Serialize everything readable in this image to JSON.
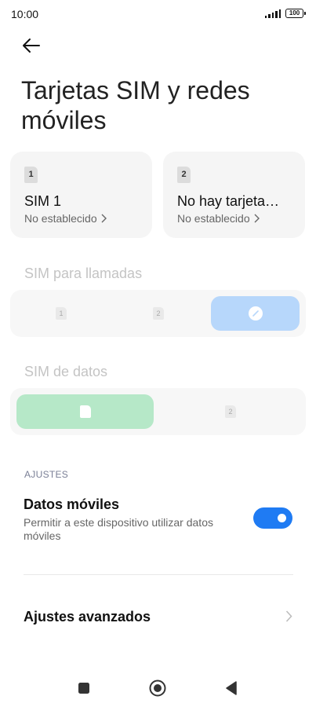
{
  "status_bar": {
    "time": "10:00",
    "battery": "100"
  },
  "header": {
    "back_icon": "arrow-left-icon",
    "title": "Tarjetas SIM y redes móviles"
  },
  "sim_cards": [
    {
      "chip": "1",
      "name": "SIM 1",
      "status": "No establecido"
    },
    {
      "chip": "2",
      "name": "No hay tarjeta…",
      "status": "No establecido"
    }
  ],
  "calls_section": {
    "label": "SIM para llamadas",
    "options": [
      "1",
      "2"
    ],
    "selected_icon": "pencil-icon"
  },
  "data_section": {
    "label": "SIM de datos",
    "options": [
      "1",
      "2"
    ],
    "selected": "1"
  },
  "settings": {
    "header": "AJUSTES",
    "mobile_data": {
      "title": "Datos móviles",
      "description": "Permitir a este dispositivo utilizar datos móviles",
      "enabled": true
    },
    "advanced": {
      "title": "Ajustes avanzados"
    }
  },
  "colors": {
    "accent": "#1f7bf3",
    "call_selected": "#b7d7fb",
    "data_selected": "#b6e8c8"
  },
  "nav_bar": [
    "square-icon",
    "home-circle-icon",
    "back-triangle-icon"
  ]
}
